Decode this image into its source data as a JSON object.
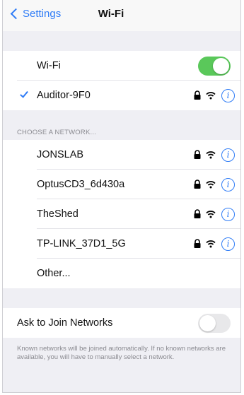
{
  "nav": {
    "back_label": "Settings",
    "title": "Wi-Fi"
  },
  "wifi_toggle": {
    "label": "Wi-Fi",
    "state": "on"
  },
  "connected": {
    "name": "Auditor-9F0"
  },
  "choose_header": "CHOOSE A NETWORK...",
  "networks": [
    {
      "name": "JONSLAB"
    },
    {
      "name": "OptusCD3_6d430a"
    },
    {
      "name": "TheShed"
    },
    {
      "name": "TP-LINK_37D1_5G"
    }
  ],
  "other_label": "Other...",
  "ask_join": {
    "label": "Ask to Join Networks",
    "state": "off"
  },
  "footer": "Known networks will be joined automatically. If no known networks are available, you will have to manually select a network.",
  "info_glyph": "i",
  "icons": {
    "lock": "lock-icon",
    "wifi": "wifi-signal-icon",
    "info": "info-icon"
  },
  "colors": {
    "accent": "#2f7cf6",
    "toggle_on": "#5ac85a"
  }
}
